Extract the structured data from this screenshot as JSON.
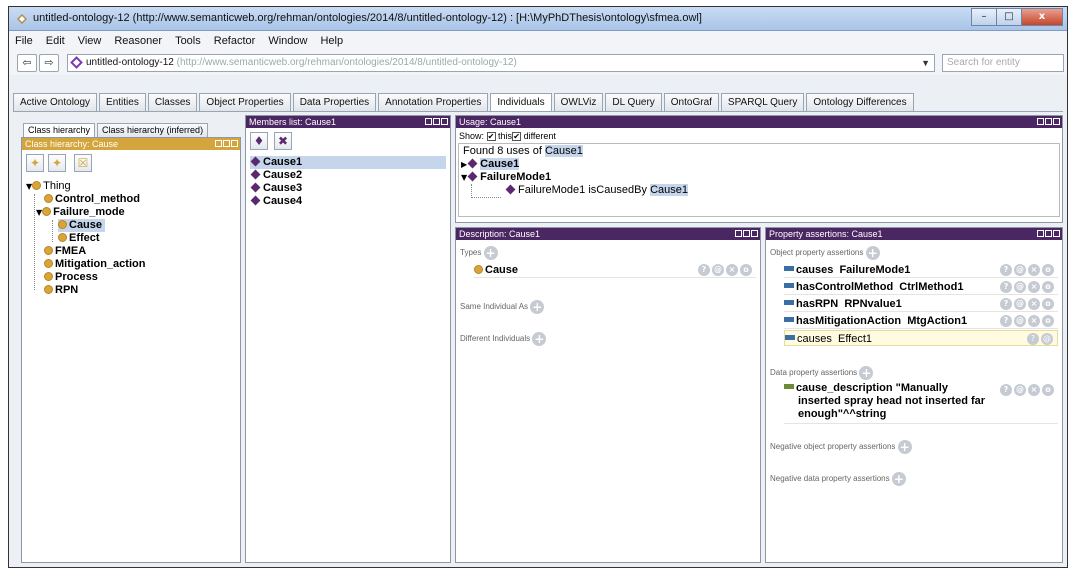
{
  "window": {
    "title": "untitled-ontology-12 (http://www.semanticweb.org/rehman/ontologies/2014/8/untitled-ontology-12) : [H:\\MyPhDThesis\\ontology\\sfmea.owl]",
    "minimize": "–",
    "maximize": "□",
    "close": "x"
  },
  "menu": [
    "File",
    "Edit",
    "View",
    "Reasoner",
    "Tools",
    "Refactor",
    "Window",
    "Help"
  ],
  "address": {
    "back": "⇦",
    "forward": "⇨",
    "ontology_name": "untitled-ontology-12",
    "ontology_iri": "(http://www.semanticweb.org/rehman/ontologies/2014/8/untitled-ontology-12)",
    "dropdown": "▼",
    "search_placeholder": "Search for entity"
  },
  "tabs": [
    "Active Ontology",
    "Entities",
    "Classes",
    "Object Properties",
    "Data Properties",
    "Annotation Properties",
    "Individuals",
    "OWLViz",
    "DL Query",
    "OntoGraf",
    "SPARQL Query",
    "Ontology Differences"
  ],
  "active_tab": "Individuals",
  "class_panel": {
    "subtabs": [
      "Class hierarchy",
      "Class hierarchy (inferred)"
    ],
    "header": "Class hierarchy: Cause",
    "tools": [
      "✦",
      "✦",
      "☒"
    ],
    "tree": {
      "root": "Thing",
      "control_method": "Control_method",
      "failure_mode": "Failure_mode",
      "cause": "Cause",
      "effect": "Effect",
      "fmea": "FMEA",
      "mitigation_action": "Mitigation_action",
      "process": "Process",
      "rpn": "RPN"
    }
  },
  "members_panel": {
    "header": "Members list: Cause1",
    "tools": [
      "♦",
      "✖"
    ],
    "items": [
      "Cause1",
      "Cause2",
      "Cause3",
      "Cause4"
    ]
  },
  "usage_panel": {
    "header": "Usage: Cause1",
    "show_label": "Show:",
    "this_label": "this",
    "different_label": "different",
    "found_prefix": "Found 8 uses of",
    "found_entity": "Cause1",
    "tree": {
      "cause1": "Cause1",
      "failuremode1": "FailureMode1",
      "axiom_subject": "FailureMode1 isCausedBy",
      "axiom_object": "Cause1"
    }
  },
  "description_panel": {
    "header": "Description: Cause1",
    "types_label": "Types",
    "type_value": "Cause",
    "same_individual_label": "Same Individual As",
    "different_individuals_label": "Different Individuals"
  },
  "property_panel": {
    "header": "Property assertions: Cause1",
    "object_label": "Object property assertions",
    "object_assertions": [
      {
        "prop": "causes",
        "value": "FailureMode1"
      },
      {
        "prop": "hasControlMethod",
        "value": "CtrlMethod1"
      },
      {
        "prop": "hasRPN",
        "value": "RPNvalue1"
      },
      {
        "prop": "hasMitigationAction",
        "value": "MtgAction1"
      },
      {
        "prop": "causes",
        "value": "Effect1"
      }
    ],
    "data_label": "Data property assertions",
    "data_assertion": {
      "line1": "cause_description  \"Manually",
      "line2": "inserted spray head not inserted far",
      "line3": "enough\"^^string"
    },
    "negative_object_label": "Negative object property assertions",
    "negative_data_label": "Negative data property assertions"
  },
  "chips": {
    "q": "?",
    "at": "@",
    "x": "×",
    "o": "o",
    "plus": "+"
  }
}
